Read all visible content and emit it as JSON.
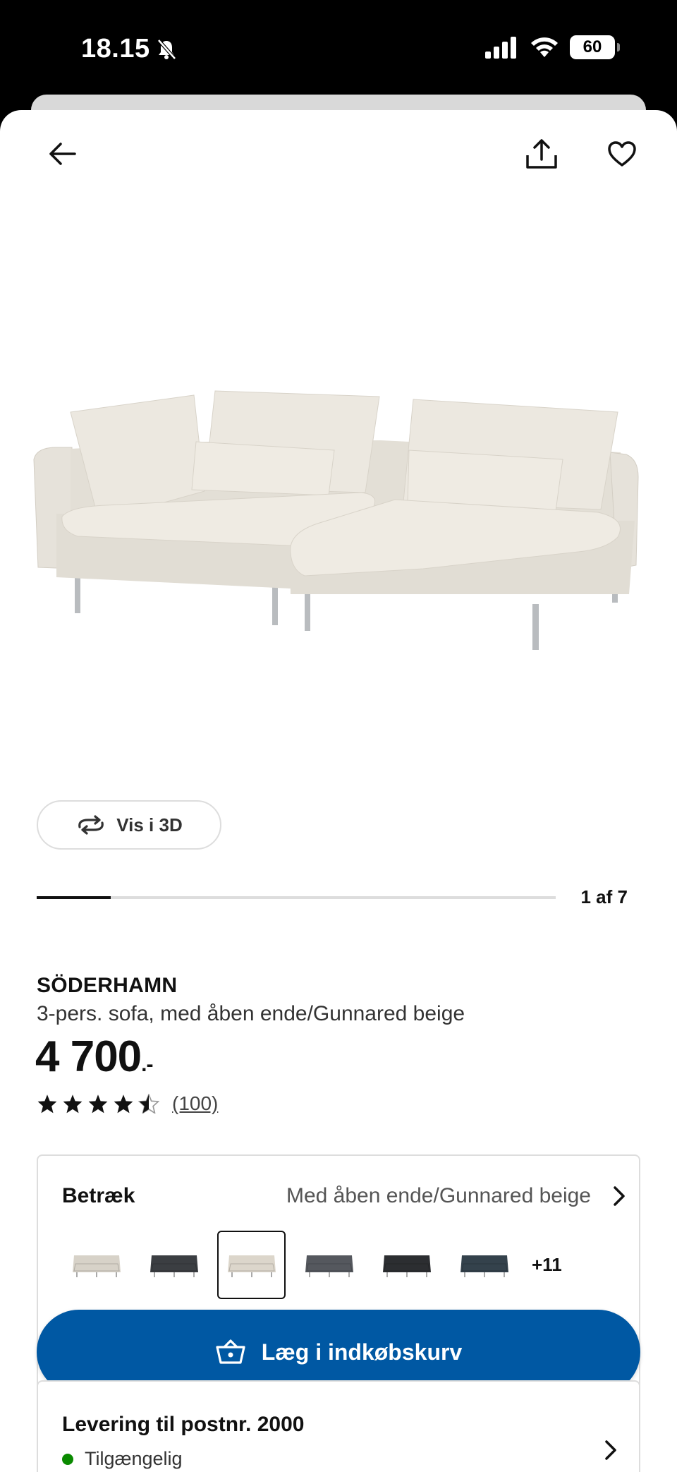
{
  "status_bar": {
    "time": "18.15",
    "battery": "60"
  },
  "product": {
    "brand": "SÖDERHAMN",
    "description": "3-pers. sofa, med åben ende/Gunnared beige",
    "price": "4 700",
    "price_suffix": ".-",
    "rating": 4.5,
    "review_count": "(100)"
  },
  "gallery": {
    "view_3d_label": "Vis i 3D",
    "counter": "1 af 7",
    "progress_fraction": 0.143
  },
  "cover": {
    "label": "Betræk",
    "value": "Med åben ende/Gunnared beige",
    "swatches": [
      {
        "color": "#d7d2c8"
      },
      {
        "color": "#3b3e42"
      },
      {
        "color": "#dcd6cb",
        "selected": true
      },
      {
        "color": "#55585e"
      },
      {
        "color": "#2c2e31"
      },
      {
        "color": "#34424c"
      }
    ],
    "more_label": "+11"
  },
  "cta": {
    "label": "Læg i indkøbskurv",
    "color": "#0058a3"
  },
  "delivery": {
    "title": "Levering til postnr. 2000",
    "status": "Tilgængelig",
    "status_color": "#0a8a00"
  }
}
